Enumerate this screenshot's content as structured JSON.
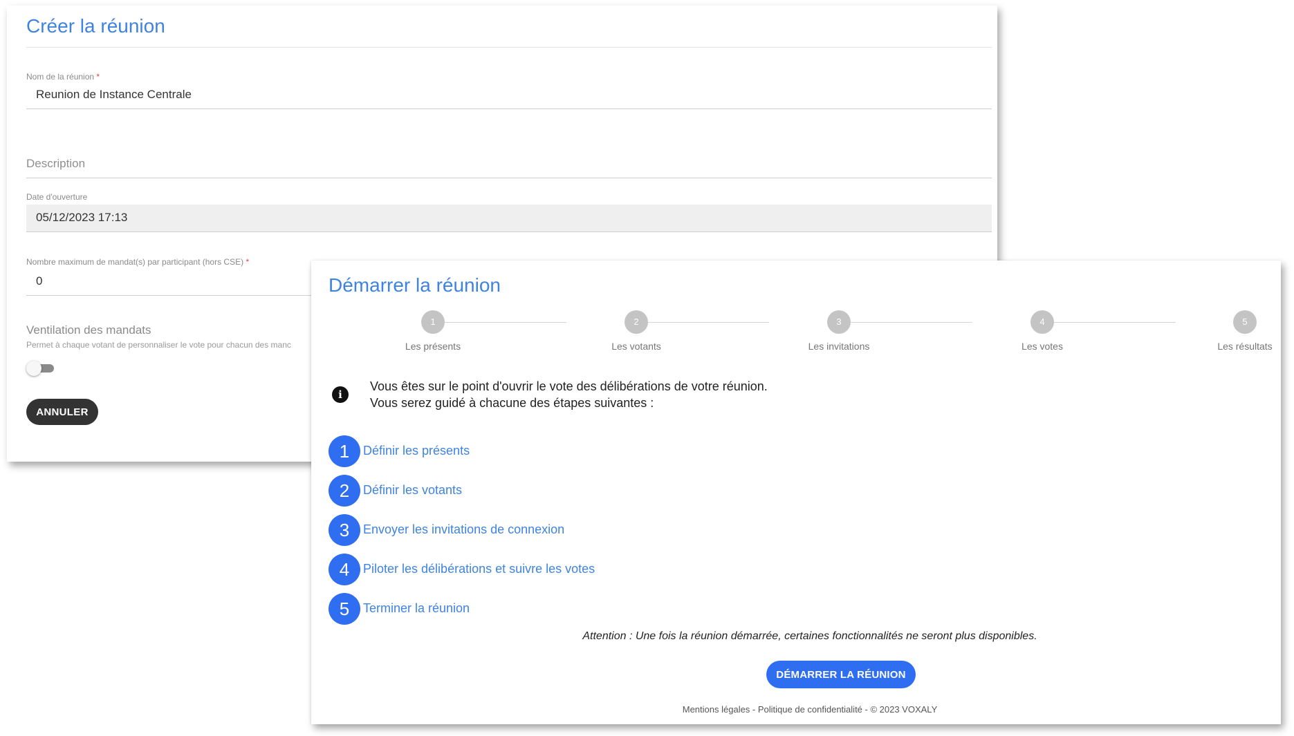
{
  "create_meeting": {
    "title": "Créer la réunion",
    "name_field": {
      "label": "Nom de la réunion",
      "required_mark": "*",
      "value": "Reunion de Instance Centrale"
    },
    "description_field": {
      "placeholder": "Description"
    },
    "date_field": {
      "label": "Date d'ouverture",
      "value": "05/12/2023 17:13"
    },
    "max_mandates_field": {
      "label": "Nombre maximum de mandat(s) par participant (hors CSE)",
      "required_mark": "*",
      "value": "0"
    },
    "ventilation": {
      "title": "Ventilation des mandats",
      "subtitle": "Permet à chaque votant de personnaliser le vote pour chacun des manc",
      "toggle_on": false
    },
    "cancel_label": "ANNULER"
  },
  "start_meeting": {
    "title": "Démarrer la réunion",
    "stepper": [
      {
        "number": "1",
        "label": "Les présents"
      },
      {
        "number": "2",
        "label": "Les votants"
      },
      {
        "number": "3",
        "label": "Les invitations"
      },
      {
        "number": "4",
        "label": "Les votes"
      },
      {
        "number": "5",
        "label": "Les résultats"
      }
    ],
    "info": {
      "icon": "info-icon",
      "line1": "Vous êtes sur le point d'ouvrir le vote des délibérations de votre réunion.",
      "line2": "Vous serez guidé à chacune des étapes suivantes :"
    },
    "steps": [
      {
        "number": "1",
        "label": "Définir les présents"
      },
      {
        "number": "2",
        "label": "Définir les votants"
      },
      {
        "number": "3",
        "label": "Envoyer les invitations de connexion"
      },
      {
        "number": "4",
        "label": "Piloter les délibérations et suivre les votes"
      },
      {
        "number": "5",
        "label": "Terminer la réunion"
      }
    ],
    "attention": "Attention : Une fois la réunion démarrée, certaines fonctionnalités ne seront plus disponibles.",
    "start_label": "DÉMARRER LA RÉUNION",
    "footer": "Mentions légales - Politique de confidentialité - © 2023 VOXALY"
  },
  "colors": {
    "accent": "#3f83e0",
    "primary_button": "#2f6ef1",
    "dark_button": "#333333",
    "step_inactive": "#c4c4c4"
  }
}
